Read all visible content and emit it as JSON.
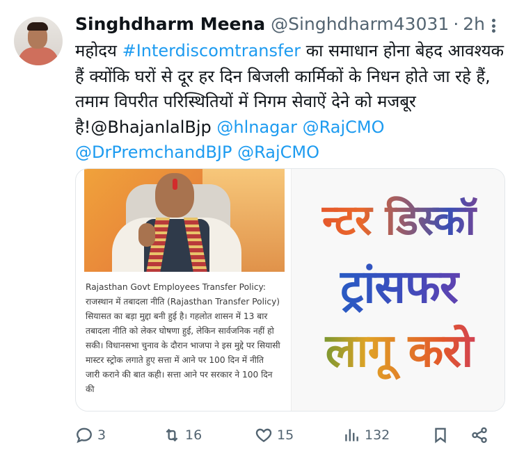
{
  "tweet": {
    "author_name": "Singhdharm Meena",
    "author_handle": "@Singhdharm43031",
    "separator": "·",
    "time": "2h",
    "text_segments": [
      {
        "text": "महोदय ",
        "link": false
      },
      {
        "text": "#Interdiscomtransfer",
        "link": true
      },
      {
        "text": " का समाधान होना बेहद आवश्यक हैं क्योंकि घरों से दूर हर दिन बिजली कार्मिकों के निधन होते जा रहे हैं, तमाम विपरीत परिस्थितियों में निगम सेवाऐं देने को मजबूर है!@BhajanlalBjp ",
        "link": false
      },
      {
        "text": "@hlnagar",
        "link": true
      },
      {
        "text": " ",
        "link": false
      },
      {
        "text": "@RajCMO",
        "link": true
      },
      {
        "text": " ",
        "link": false
      },
      {
        "text": "@DrPremchandBJP",
        "link": true
      },
      {
        "text": " ",
        "link": false
      },
      {
        "text": "@RajCMO",
        "link": true
      }
    ]
  },
  "media": {
    "article_text": "Rajasthan Govt Employees Transfer Policy: राजस्थान में तबादला नीति (Rajasthan Transfer Policy) सियासत का बड़ा मुद्दा बनी हुई है। गहलोत शासन में 13 बार तबादला नीति को लेकर घोषणा हुई, लेकिन सार्वजनिक नहीं हो सकी। विधानसभा चुनाव के दौरान भाजपा ने इस मुद्दे पर सियासी मास्टर स्ट्रोक लगाते हुए सत्ता में आने पर 100 दिन में नीति जारी कराने की बात कही। सत्ता आने पर सरकार ने 100 दिन की",
    "poster_lines": [
      "न्टर डिस्कॉ",
      "ट्रांसफर",
      "लागू करो"
    ]
  },
  "actions": {
    "reply_count": "3",
    "retweet_count": "16",
    "like_count": "15",
    "view_count": "132"
  },
  "colors": {
    "link": "#1d9bf0",
    "muted": "#536471",
    "text": "#0f1419"
  },
  "icons": [
    "more-icon",
    "reply-icon",
    "retweet-icon",
    "like-icon",
    "views-icon",
    "bookmark-icon",
    "share-icon"
  ]
}
